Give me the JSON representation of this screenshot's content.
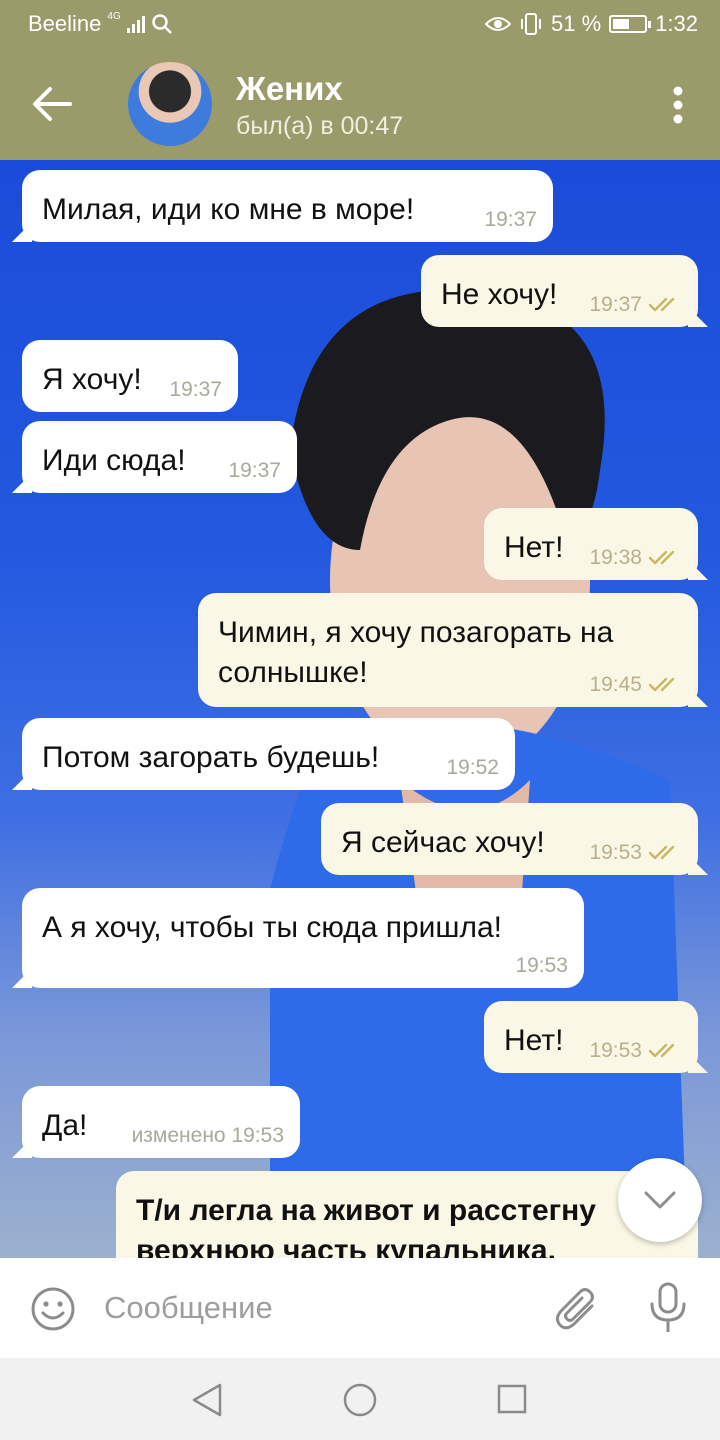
{
  "status_bar": {
    "carrier": "Beeline",
    "network": "4G",
    "battery": "51 %",
    "time": "1:32"
  },
  "header": {
    "name": "Жених",
    "status": "был(а) в 00:47"
  },
  "messages": [
    {
      "dir": "in",
      "text": "Милая, иди ко мне в море!",
      "time": "19:37"
    },
    {
      "dir": "out",
      "text": "Не хочу!",
      "time": "19:37"
    },
    {
      "dir": "in",
      "text": "Я хочу!",
      "time": "19:37"
    },
    {
      "dir": "in",
      "text": "Иди сюда!",
      "time": "19:37"
    },
    {
      "dir": "out",
      "text": "Нет!",
      "time": "19:38"
    },
    {
      "dir": "out",
      "text_line1": "Чимин, я хочу позагорать на",
      "text_line2": "солнышке!",
      "time": "19:45"
    },
    {
      "dir": "in",
      "text": "Потом загорать будешь!",
      "time": "19:52"
    },
    {
      "dir": "out",
      "text": "Я сейчас хочу!",
      "time": "19:53"
    },
    {
      "dir": "in",
      "text": "А я хочу, чтобы ты сюда пришла!",
      "time": "19:53"
    },
    {
      "dir": "out",
      "text": "Нет!",
      "time": "19:53"
    },
    {
      "dir": "in",
      "text": "Да!",
      "time": "изменено 19:53"
    },
    {
      "dir": "out",
      "text_line1": "Т/и легла на живот и расстегну",
      "text_line2": "верхнюю часть купальника."
    }
  ],
  "composer": {
    "placeholder": "Сообщение"
  },
  "colors": {
    "header": "#9b9a6b",
    "incoming_bubble": "#ffffff",
    "outgoing_bubble": "#fbf7e6",
    "read_checks": "#c9b760"
  }
}
